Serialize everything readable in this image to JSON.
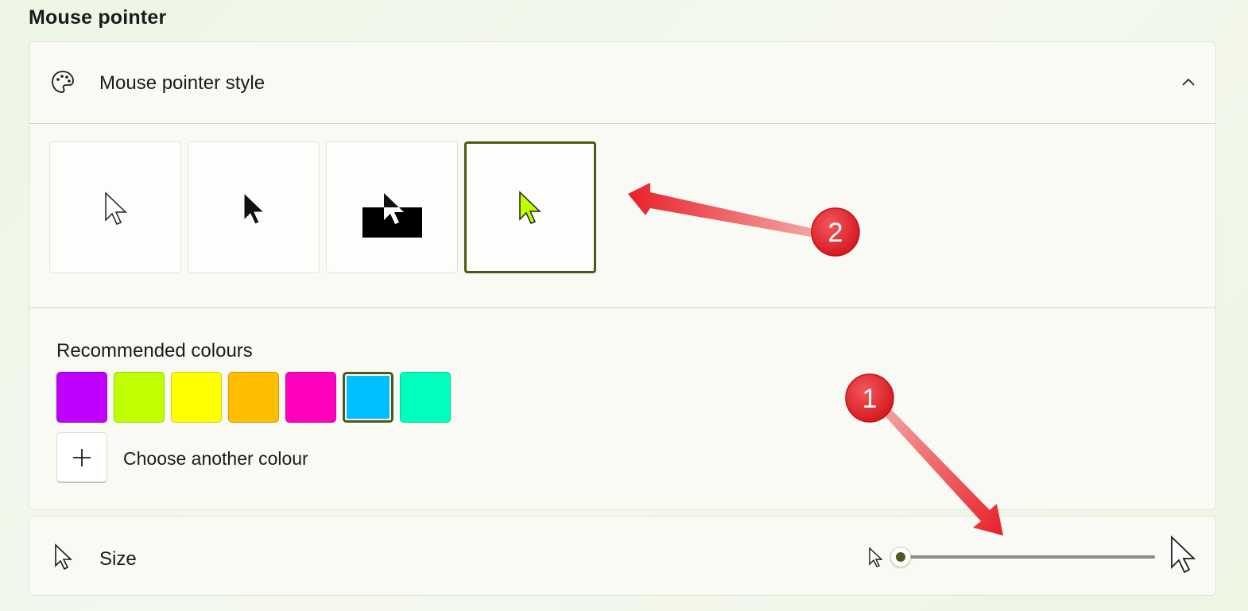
{
  "section_title": "Mouse pointer",
  "style_card": {
    "label": "Mouse pointer style",
    "icon": "palette-icon",
    "expanded": true,
    "styles": [
      {
        "name": "white",
        "icon": "white-pointer-icon",
        "selected": false
      },
      {
        "name": "black",
        "icon": "black-pointer-icon",
        "selected": false
      },
      {
        "name": "inverted",
        "icon": "inverted-pointer-icon",
        "selected": false
      },
      {
        "name": "custom",
        "icon": "custom-pointer-icon",
        "selected": true
      }
    ]
  },
  "colours": {
    "label": "Recommended colours",
    "swatches": [
      {
        "color": "#BF00FF",
        "selected": false
      },
      {
        "color": "#BFFF00",
        "selected": false
      },
      {
        "color": "#FFFF00",
        "selected": false
      },
      {
        "color": "#FFBF00",
        "selected": false
      },
      {
        "color": "#FF00BF",
        "selected": false
      },
      {
        "color": "#00BFFF",
        "selected": true
      },
      {
        "color": "#00FFBF",
        "selected": false
      }
    ],
    "choose_label": "Choose another colour"
  },
  "size": {
    "label": "Size",
    "value": 1
  },
  "annotations": [
    {
      "number": "1"
    },
    {
      "number": "2"
    }
  ],
  "colors": {
    "accent": "#4D5A14",
    "custom_pointer": "#BFFF00",
    "annotation": "#E8202A"
  }
}
